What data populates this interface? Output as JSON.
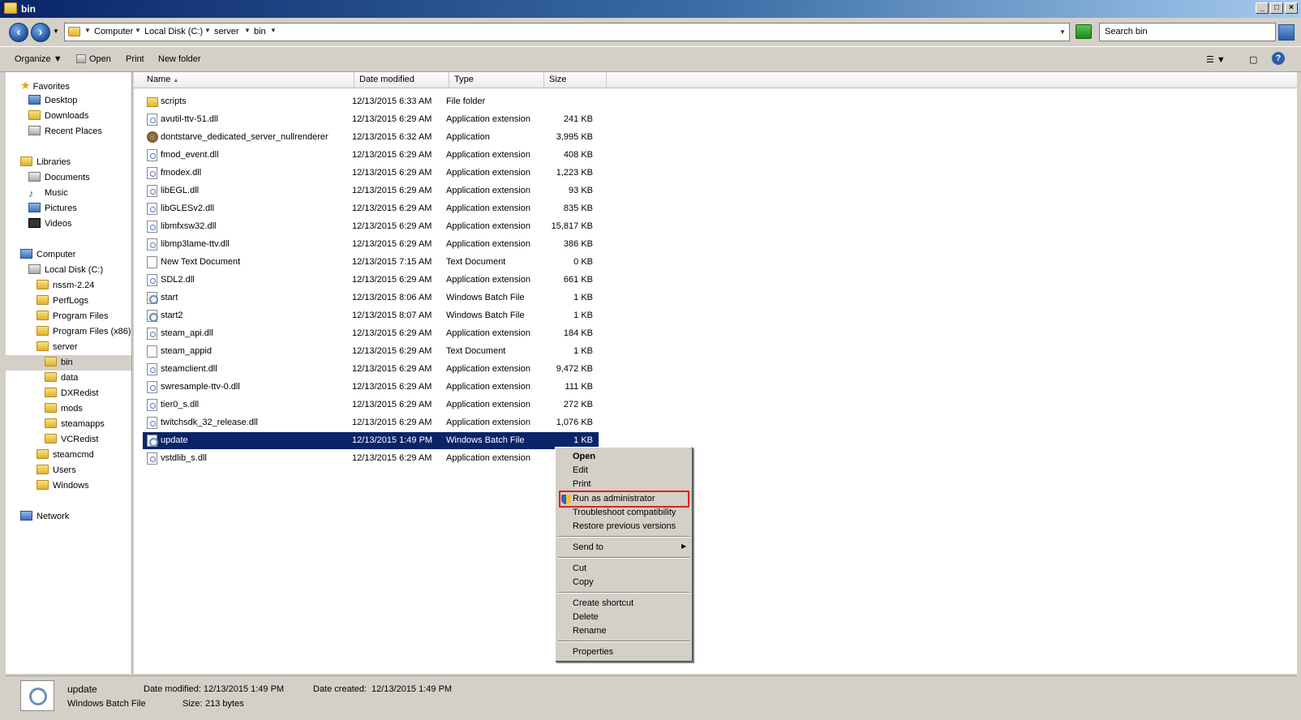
{
  "window": {
    "title": "bin"
  },
  "address": {
    "crumbs": [
      "Computer",
      "Local Disk (C:)",
      "server",
      "bin"
    ],
    "search_placeholder": "Search bin"
  },
  "toolbar": {
    "organize": "Organize",
    "open": "Open",
    "print": "Print",
    "new_folder": "New folder"
  },
  "nav": {
    "favorites": "Favorites",
    "desktop": "Desktop",
    "downloads": "Downloads",
    "recent_places": "Recent Places",
    "libraries": "Libraries",
    "documents": "Documents",
    "music": "Music",
    "pictures": "Pictures",
    "videos": "Videos",
    "computer": "Computer",
    "local_disk": "Local Disk (C:)",
    "folders": [
      "nssm-2.24",
      "PerfLogs",
      "Program Files",
      "Program Files (x86)",
      "server"
    ],
    "server_children": [
      "bin",
      "data",
      "DXRedist",
      "mods",
      "steamapps",
      "VCRedist"
    ],
    "more_folders": [
      "steamcmd",
      "Users",
      "Windows"
    ],
    "network": "Network"
  },
  "columns": {
    "name": "Name",
    "date": "Date modified",
    "type": "Type",
    "size": "Size"
  },
  "files": [
    {
      "name": "scripts",
      "date": "12/13/2015 6:33 AM",
      "type": "File folder",
      "size": "",
      "icon": "folder-icon"
    },
    {
      "name": "avutil-ttv-51.dll",
      "date": "12/13/2015 6:29 AM",
      "type": "Application extension",
      "size": "241 KB",
      "icon": "dll-icon"
    },
    {
      "name": "dontstarve_dedicated_server_nullrenderer",
      "date": "12/13/2015 6:32 AM",
      "type": "Application",
      "size": "3,995 KB",
      "icon": "app-icon"
    },
    {
      "name": "fmod_event.dll",
      "date": "12/13/2015 6:29 AM",
      "type": "Application extension",
      "size": "408 KB",
      "icon": "dll-icon"
    },
    {
      "name": "fmodex.dll",
      "date": "12/13/2015 6:29 AM",
      "type": "Application extension",
      "size": "1,223 KB",
      "icon": "dll-icon"
    },
    {
      "name": "libEGL.dll",
      "date": "12/13/2015 6:29 AM",
      "type": "Application extension",
      "size": "93 KB",
      "icon": "dll-icon"
    },
    {
      "name": "libGLESv2.dll",
      "date": "12/13/2015 6:29 AM",
      "type": "Application extension",
      "size": "835 KB",
      "icon": "dll-icon"
    },
    {
      "name": "libmfxsw32.dll",
      "date": "12/13/2015 6:29 AM",
      "type": "Application extension",
      "size": "15,817 KB",
      "icon": "dll-icon"
    },
    {
      "name": "libmp3lame-ttv.dll",
      "date": "12/13/2015 6:29 AM",
      "type": "Application extension",
      "size": "386 KB",
      "icon": "dll-icon"
    },
    {
      "name": "New Text Document",
      "date": "12/13/2015 7:15 AM",
      "type": "Text Document",
      "size": "0 KB",
      "icon": "text-file-icon"
    },
    {
      "name": "SDL2.dll",
      "date": "12/13/2015 6:29 AM",
      "type": "Application extension",
      "size": "661 KB",
      "icon": "dll-icon"
    },
    {
      "name": "start",
      "date": "12/13/2015 8:06 AM",
      "type": "Windows Batch File",
      "size": "1 KB",
      "icon": "batch-file-icon"
    },
    {
      "name": "start2",
      "date": "12/13/2015 8:07 AM",
      "type": "Windows Batch File",
      "size": "1 KB",
      "icon": "batch-file-icon"
    },
    {
      "name": "steam_api.dll",
      "date": "12/13/2015 6:29 AM",
      "type": "Application extension",
      "size": "184 KB",
      "icon": "dll-icon"
    },
    {
      "name": "steam_appid",
      "date": "12/13/2015 6:29 AM",
      "type": "Text Document",
      "size": "1 KB",
      "icon": "text-file-icon"
    },
    {
      "name": "steamclient.dll",
      "date": "12/13/2015 6:29 AM",
      "type": "Application extension",
      "size": "9,472 KB",
      "icon": "dll-icon"
    },
    {
      "name": "swresample-ttv-0.dll",
      "date": "12/13/2015 6:29 AM",
      "type": "Application extension",
      "size": "111 KB",
      "icon": "dll-icon"
    },
    {
      "name": "tier0_s.dll",
      "date": "12/13/2015 6:29 AM",
      "type": "Application extension",
      "size": "272 KB",
      "icon": "dll-icon"
    },
    {
      "name": "twitchsdk_32_release.dll",
      "date": "12/13/2015 6:29 AM",
      "type": "Application extension",
      "size": "1,076 KB",
      "icon": "dll-icon"
    },
    {
      "name": "update",
      "date": "12/13/2015 1:49 PM",
      "type": "Windows Batch File",
      "size": "1 KB",
      "icon": "batch-file-icon",
      "selected": true
    },
    {
      "name": "vstdlib_s.dll",
      "date": "12/13/2015 6:29 AM",
      "type": "Application extension",
      "size": "",
      "icon": "dll-icon"
    }
  ],
  "context_menu": {
    "open": "Open",
    "edit": "Edit",
    "print": "Print",
    "run_as_admin": "Run as administrator",
    "troubleshoot": "Troubleshoot compatibility",
    "restore": "Restore previous versions",
    "send_to": "Send to",
    "cut": "Cut",
    "copy": "Copy",
    "create_shortcut": "Create shortcut",
    "delete": "Delete",
    "rename": "Rename",
    "properties": "Properties",
    "highlight_color": "#e0201c"
  },
  "details": {
    "name": "update",
    "type": "Windows Batch File",
    "date_modified_label": "Date modified:",
    "date_modified": "12/13/2015 1:49 PM",
    "date_created_label": "Date created:",
    "date_created": "12/13/2015 1:49 PM",
    "size_label": "Size:",
    "size": "213 bytes"
  },
  "colors": {
    "selection": "#0a246a",
    "chrome": "#d4d0c8"
  }
}
